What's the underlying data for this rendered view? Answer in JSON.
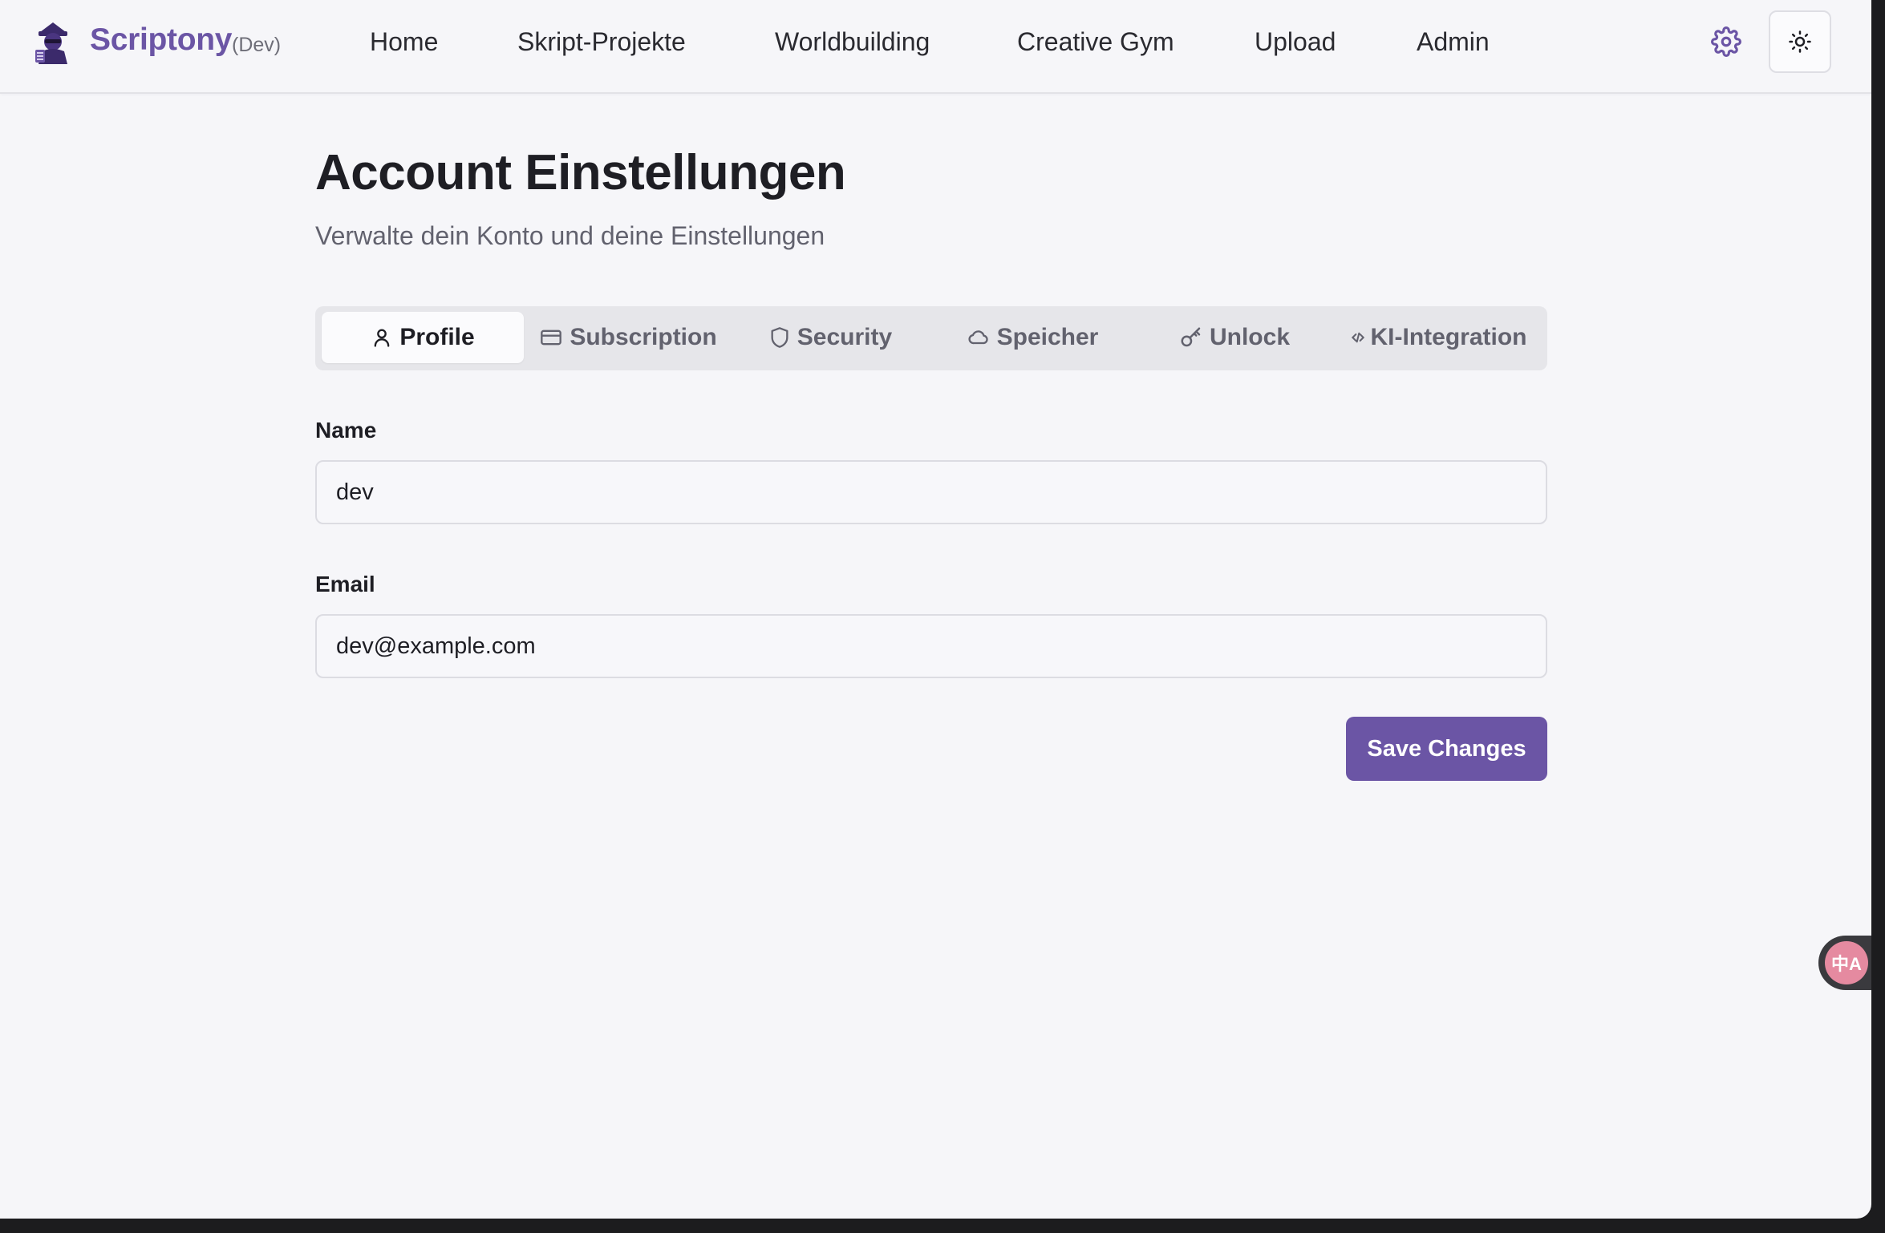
{
  "app": {
    "name": "Scriptony",
    "env_tag": "(Dev)",
    "brand_color": "#6b55a5"
  },
  "nav": {
    "items": [
      {
        "label": "Home"
      },
      {
        "label": "Skript-Projekte"
      },
      {
        "label": "Worldbuilding"
      },
      {
        "label": "Creative Gym"
      },
      {
        "label": "Upload"
      },
      {
        "label": "Admin"
      }
    ],
    "settings_icon": "gear-icon",
    "theme_icon": "sun-icon"
  },
  "page": {
    "title": "Account Einstellungen",
    "subtitle": "Verwalte dein Konto und deine Einstellungen"
  },
  "tabs": [
    {
      "label": "Profile",
      "icon": "user-icon",
      "active": true
    },
    {
      "label": "Subscription",
      "icon": "credit-card-icon",
      "active": false
    },
    {
      "label": "Security",
      "icon": "shield-icon",
      "active": false
    },
    {
      "label": "Speicher",
      "icon": "cloud-icon",
      "active": false
    },
    {
      "label": "Unlock",
      "icon": "key-icon",
      "active": false
    },
    {
      "label": "KI-Integration",
      "icon": "code-icon",
      "active": false
    }
  ],
  "form": {
    "name_label": "Name",
    "name_value": "dev",
    "email_label": "Email",
    "email_value": "dev@example.com",
    "save_label": "Save Changes"
  },
  "translate_widget": {
    "icon": "translate-icon",
    "glyph": "中A"
  }
}
